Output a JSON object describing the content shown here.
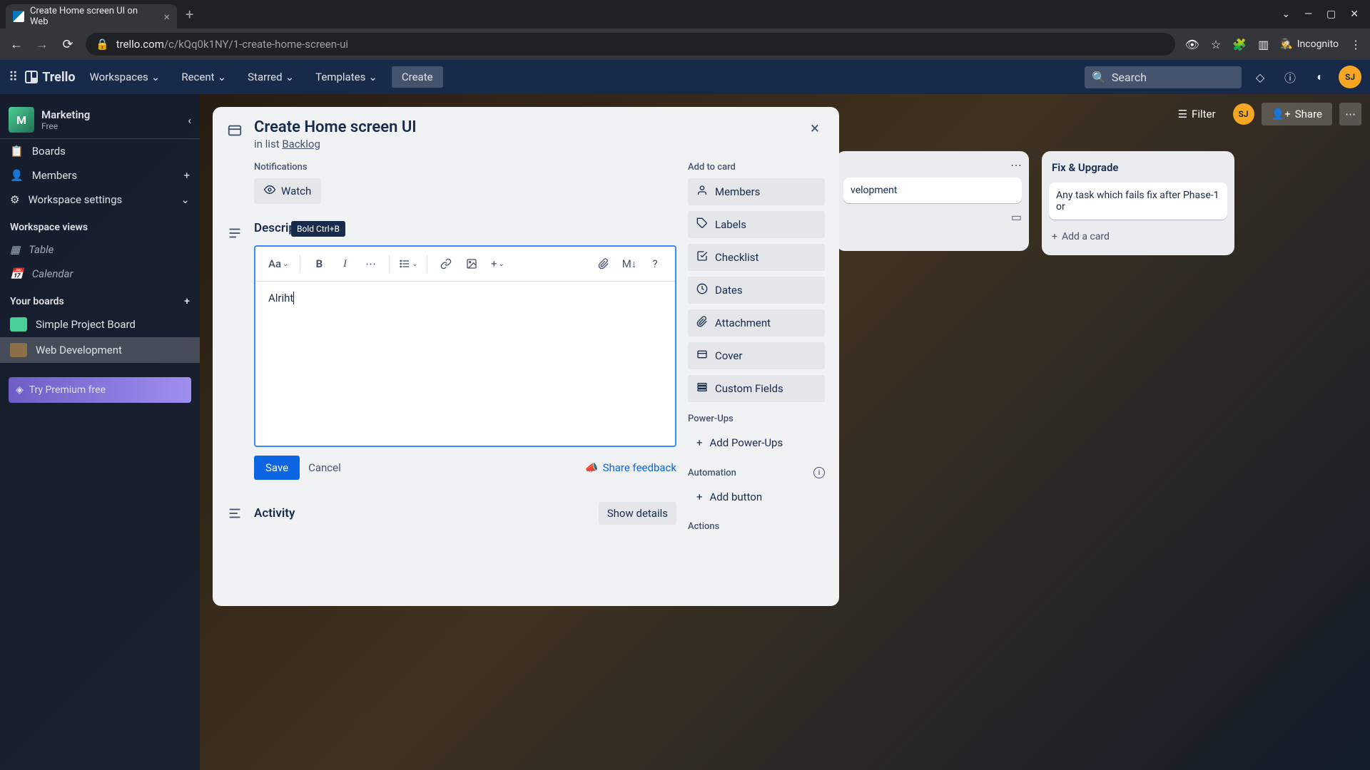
{
  "browser": {
    "tab_title": "Create Home screen UI on Web",
    "url_domain": "trello.com",
    "url_path": "/c/kQq0k1NY/1-create-home-screen-ui",
    "incognito": "Incognito"
  },
  "trello_header": {
    "logo": "Trello",
    "nav": {
      "workspaces": "Workspaces",
      "recent": "Recent",
      "starred": "Starred",
      "templates": "Templates"
    },
    "create": "Create",
    "search_placeholder": "Search"
  },
  "sidebar": {
    "workspace": {
      "initial": "M",
      "name": "Marketing",
      "plan": "Free"
    },
    "boards": "Boards",
    "members": "Members",
    "settings": "Workspace settings",
    "views_label": "Workspace views",
    "table": "Table",
    "calendar": "Calendar",
    "your_boards_label": "Your boards",
    "board1": "Simple Project Board",
    "board2": "Web Development",
    "premium": "Try Premium free"
  },
  "board_bg": {
    "filter": "Filter",
    "share": "Share",
    "avatar": "SJ",
    "list1_title": "",
    "list1_card": "velopment",
    "list2_title": "Fix & Upgrade",
    "list2_card": "Any task which fails fix after Phase-1 or",
    "add_card": "Add a card"
  },
  "modal": {
    "title": "Create Home screen UI",
    "subtitle_prefix": "in list ",
    "subtitle_list": "Backlog",
    "notifications_label": "Notifications",
    "watch": "Watch",
    "description_label": "Description",
    "tooltip": "Bold Ctrl+B",
    "toolbar": {
      "text_style": "Aa",
      "markdown": "M↓"
    },
    "editor_content": "Alriht",
    "save": "Save",
    "cancel": "Cancel",
    "feedback": "Share feedback",
    "activity_label": "Activity",
    "show_details": "Show details",
    "side": {
      "add_to_card": "Add to card",
      "members": "Members",
      "labels": "Labels",
      "checklist": "Checklist",
      "dates": "Dates",
      "attachment": "Attachment",
      "cover": "Cover",
      "custom_fields": "Custom Fields",
      "power_ups": "Power-Ups",
      "add_power_ups": "Add Power-Ups",
      "automation": "Automation",
      "add_button": "Add button",
      "actions": "Actions"
    }
  }
}
